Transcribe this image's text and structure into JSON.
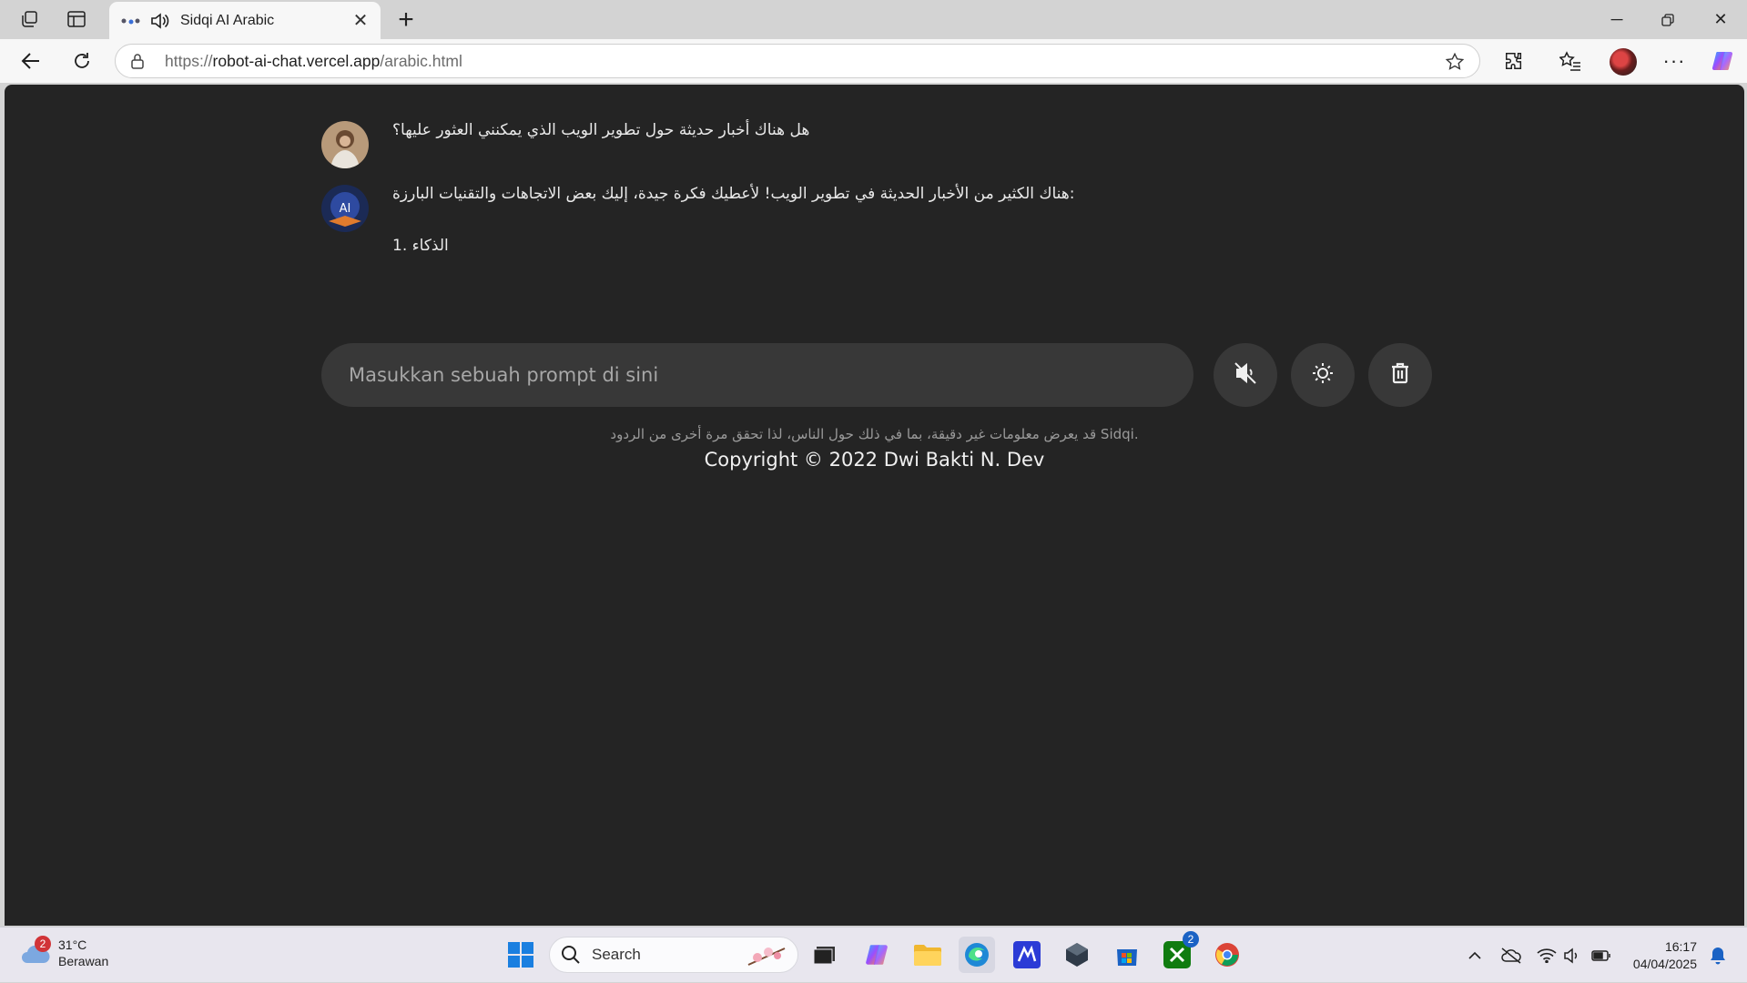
{
  "browser": {
    "tab_title": "Sidqi AI Arabic",
    "url_prefix": "https://",
    "url_host": "robot-ai-chat.vercel.app",
    "url_path": "/arabic.html"
  },
  "chat": {
    "messages": [
      {
        "role": "user",
        "text": "هل هناك أخبار حديثة حول تطوير الويب الذي يمكنني العثور عليها؟"
      },
      {
        "role": "bot",
        "text": "هناك الكثير من الأخبار الحديثة في تطوير الويب!  لأعطيك فكرة جيدة، إليك بعض الاتجاهات والتقنيات البارزة:",
        "text2": "1. الذكاء"
      }
    ],
    "avatar_bot_label": "AI",
    "prompt_placeholder": "Masukkan sebuah prompt di sini",
    "disclaimer": "قد يعرض معلومات غير دقيقة، بما في ذلك حول الناس، لذا تحقق مرة أخرى من الردود Sidqi.",
    "copyright": "Copyright © 2022 Dwi Bakti N. Dev"
  },
  "taskbar": {
    "weather_temp": "31°C",
    "weather_desc": "Berawan",
    "weather_badge": "2",
    "search_label": "Search",
    "xbox_badge": "2",
    "time": "16:17",
    "date": "04/04/2025"
  },
  "icons": {
    "tab_actions": "tab-actions-icon",
    "vertical_tabs": "vertical-tabs-icon",
    "mute": "speaker-muted-icon",
    "theme": "sun-icon",
    "delete": "trash-icon"
  }
}
